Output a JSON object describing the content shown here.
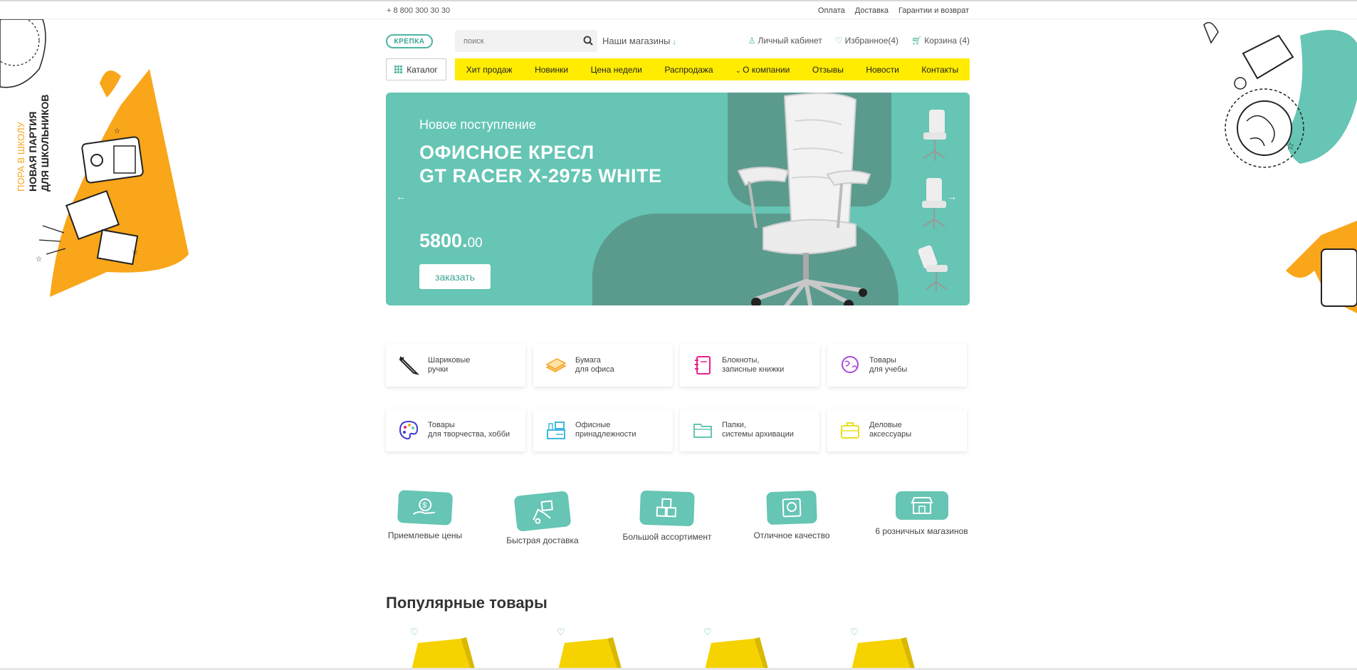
{
  "topbar": {
    "phone": "+ 8 800 300 30 30",
    "links": [
      "Оплата",
      "Доставка",
      "Гарантии и возврат"
    ]
  },
  "promo_left": {
    "line1": "ПОРА В ШКОЛУ",
    "line2": "НОВАЯ ПАРТИЯ",
    "line3": "ДЛЯ ШКОЛЬНИКОВ"
  },
  "header": {
    "logo": "КРЕПКА",
    "search_placeholder": "поиск",
    "stores": "Наши магазины",
    "account": "Личный кабинет",
    "favorites": "Избранное(4)",
    "cart": "Корзина (4)"
  },
  "nav": {
    "catalog": "Каталог",
    "items": [
      "Хит продаж",
      "Новинки",
      "Цена недели",
      "Распродажа",
      "О компании",
      "Отзывы",
      "Новости",
      "Контакты"
    ],
    "dropdown_index": 4
  },
  "banner": {
    "subtitle": "Новое поступление",
    "title_line1": "ОФИСНОЕ КРЕСЛ",
    "title_line2": "GT RACER X-2975 WHITE",
    "price_main": "5800.",
    "price_cents": "00",
    "order_button": "заказать",
    "prev_arrow": "←",
    "next_arrow": "→"
  },
  "categories": [
    {
      "label": "Шариковые\nручки",
      "icon": "pen-icon",
      "color": "#222222"
    },
    {
      "label": "Бумага\nдля офиса",
      "icon": "paper-stack-icon",
      "color": "#f5a623"
    },
    {
      "label": "Блокноты,\nзаписные книжки",
      "icon": "notebook-icon",
      "color": "#e91e8c"
    },
    {
      "label": "Товары\nдля учебы",
      "icon": "globe-icon",
      "color": "#a64bd6"
    },
    {
      "label": "Товары\nдля творчества, хобби",
      "icon": "palette-icon",
      "color": "#3d3ccf"
    },
    {
      "label": "Офисные\nпринадлежности",
      "icon": "office-desk-icon",
      "color": "#3fb8e0"
    },
    {
      "label": "Папки,\nсистемы архивации",
      "icon": "folder-icon",
      "color": "#66c5b4"
    },
    {
      "label": "Деловые\nаксессуары",
      "icon": "briefcase-icon",
      "color": "#e8e020"
    }
  ],
  "features": [
    {
      "label": "Приемлевые цены",
      "icon": "money-hand-icon"
    },
    {
      "label": "Быстрая доставка",
      "icon": "delivery-icon"
    },
    {
      "label": "Большой ассортимент",
      "icon": "boxes-icon"
    },
    {
      "label": "Отличное качество",
      "icon": "quality-icon"
    },
    {
      "label": "6 розничных магазинов",
      "icon": "store-icon"
    }
  ],
  "popular": {
    "title": "Популярные товары",
    "products": [
      {
        "favorite_icon": "heart-icon"
      },
      {
        "favorite_icon": "heart-icon"
      },
      {
        "favorite_icon": "heart-icon"
      },
      {
        "favorite_icon": "heart-icon"
      }
    ]
  },
  "colors": {
    "accent": "#66c5b4",
    "accent_dark": "#5a9b8e",
    "menu_bg": "#ffec00",
    "promo_orange": "#f9a61a"
  }
}
